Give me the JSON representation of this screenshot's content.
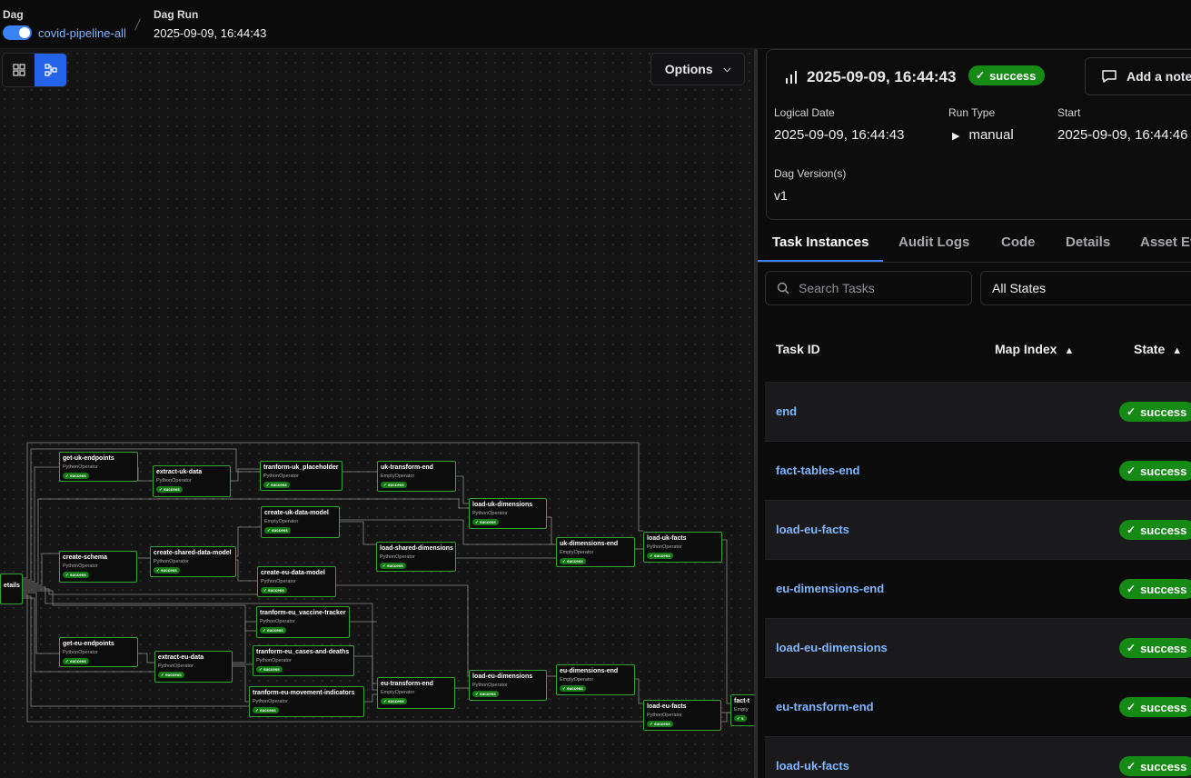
{
  "header": {
    "dag_label": "Dag",
    "dag_name": "covid-pipeline-all",
    "dagrun_label": "Dag Run",
    "dagrun_value": "2025-09-09, 16:44:43"
  },
  "graph": {
    "options_label": "Options",
    "nodes": [
      {
        "id": "n_details",
        "name": "etails",
        "operator": "",
        "status": ""
      },
      {
        "id": "n_get_uk",
        "name": "get-uk-endpoints",
        "operator": "PythonOperator",
        "status": "success"
      },
      {
        "id": "n_extract_uk",
        "name": "extract-uk-data",
        "operator": "PythonOperator",
        "status": "success"
      },
      {
        "id": "n_tr_uk",
        "name": "tranform-uk_placeholder",
        "operator": "PythonOperator",
        "status": "success"
      },
      {
        "id": "n_uk_tr_end",
        "name": "uk-transform-end",
        "operator": "EmptyOperator",
        "status": "success"
      },
      {
        "id": "n_load_uk_dim",
        "name": "load-uk-dimensions",
        "operator": "PythonOperator",
        "status": "success"
      },
      {
        "id": "n_create_uk_dm",
        "name": "create-uk-data-model",
        "operator": "EmptyOperator",
        "status": "success"
      },
      {
        "id": "n_create_schema",
        "name": "create-schema",
        "operator": "PythonOperator",
        "status": "success"
      },
      {
        "id": "n_create_shared",
        "name": "create-shared-data-model",
        "operator": "PythonOperator",
        "status": "success"
      },
      {
        "id": "n_load_shared",
        "name": "load-shared-dimensions",
        "operator": "PythonOperator",
        "status": "success"
      },
      {
        "id": "n_uk_dim_end",
        "name": "uk-dimensions-end",
        "operator": "EmptyOperator",
        "status": "success"
      },
      {
        "id": "n_load_uk_facts",
        "name": "load-uk-facts",
        "operator": "PythonOperator",
        "status": "success"
      },
      {
        "id": "n_create_eu_dm",
        "name": "create-eu-data-model",
        "operator": "PythonOperator",
        "status": "success"
      },
      {
        "id": "n_tr_eu_vac",
        "name": "tranform-eu_vaccine-tracker",
        "operator": "PythonOperator",
        "status": "success"
      },
      {
        "id": "n_get_eu",
        "name": "get-eu-endpoints",
        "operator": "PythonOperator",
        "status": "success"
      },
      {
        "id": "n_extract_eu",
        "name": "extract-eu-data",
        "operator": "PythonOperator",
        "status": "success"
      },
      {
        "id": "n_tr_eu_cases",
        "name": "tranform-eu_cases-and-deaths",
        "operator": "PythonOperator",
        "status": "success"
      },
      {
        "id": "n_load_eu_dim",
        "name": "load-eu-dimensions",
        "operator": "PythonOperator",
        "status": "success"
      },
      {
        "id": "n_eu_dim_end",
        "name": "eu-dimensions-end",
        "operator": "EmptyOperator",
        "status": "success"
      },
      {
        "id": "n_eu_tr_end",
        "name": "eu-transform-end",
        "operator": "EmptyOperator",
        "status": "success"
      },
      {
        "id": "n_tr_eu_move",
        "name": "tranform-eu-movement-indicators",
        "operator": "PythonOperator",
        "status": "success"
      },
      {
        "id": "n_load_eu_facts",
        "name": "load-eu-facts",
        "operator": "PythonOperator",
        "status": "success"
      },
      {
        "id": "n_fact_end",
        "name": "fact-t",
        "operator": "Empty",
        "status": "s"
      }
    ]
  },
  "run": {
    "title": "2025-09-09, 16:44:43",
    "state": "success",
    "add_note": "Add a note",
    "logical_date_label": "Logical Date",
    "logical_date": "2025-09-09, 16:44:43",
    "run_type_label": "Run Type",
    "run_type": "manual",
    "start_label": "Start",
    "start": "2025-09-09, 16:44:46",
    "dag_version_label": "Dag Version(s)",
    "dag_version": "v1"
  },
  "tabs": [
    "Task Instances",
    "Audit Logs",
    "Code",
    "Details",
    "Asset Ev"
  ],
  "filters": {
    "search_placeholder": "Search Tasks",
    "state_filter": "All States"
  },
  "table": {
    "columns": [
      "Task ID",
      "Map Index",
      "State"
    ],
    "rows": [
      {
        "task_id": "end",
        "state": "success"
      },
      {
        "task_id": "fact-tables-end",
        "state": "success"
      },
      {
        "task_id": "load-eu-facts",
        "state": "success"
      },
      {
        "task_id": "eu-dimensions-end",
        "state": "success"
      },
      {
        "task_id": "load-eu-dimensions",
        "state": "success"
      },
      {
        "task_id": "eu-transform-end",
        "state": "success"
      },
      {
        "task_id": "load-uk-facts",
        "state": "success"
      }
    ]
  },
  "colors": {
    "accent": "#3b82f6",
    "success": "#158a15",
    "link": "#7fb6ff",
    "node_border": "#2fa72f"
  }
}
